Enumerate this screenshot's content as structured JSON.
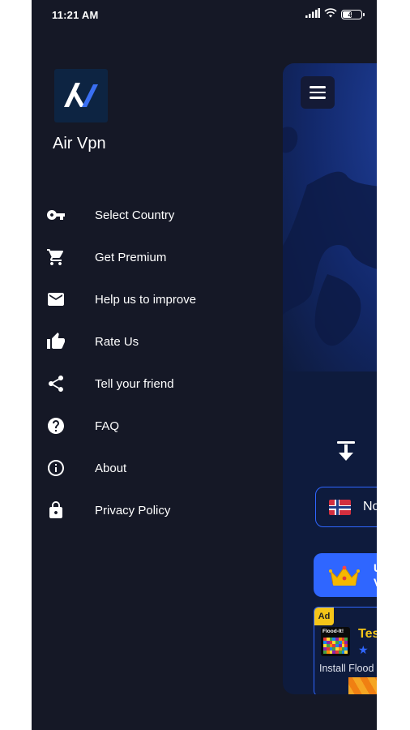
{
  "status_bar": {
    "time": "11:21 AM",
    "battery_level": "44",
    "icons": [
      "signal-icon",
      "wifi-icon",
      "battery-icon"
    ]
  },
  "drawer": {
    "app_name": "Air Vpn",
    "logo_icon": "air-vpn-logo-icon",
    "menu": [
      {
        "label": "Select Country",
        "icon": "key-icon"
      },
      {
        "label": "Get Premium",
        "icon": "cart-icon"
      },
      {
        "label": "Help us to improve",
        "icon": "mail-icon"
      },
      {
        "label": "Rate Us",
        "icon": "thumbs-up-icon"
      },
      {
        "label": "Tell your friend",
        "icon": "share-icon"
      },
      {
        "label": "FAQ",
        "icon": "help-circle-icon"
      },
      {
        "label": "About",
        "icon": "info-icon"
      },
      {
        "label": "Privacy Policy",
        "icon": "lock-icon"
      }
    ]
  },
  "main": {
    "menu_button_icon": "hamburger-icon",
    "connect_icon": "upload-arrow-icon",
    "country_partial": "No",
    "premium_partial_1": "U",
    "premium_partial_2": "V",
    "ad": {
      "badge": "Ad",
      "thumb_title": "Flood-It!",
      "title_partial": "Tes",
      "stars": "★",
      "desc_partial": "Install Flood"
    }
  },
  "colors": {
    "background": "#151826",
    "card": "#0e1b3d",
    "accent": "#2f66ff",
    "ad_yellow": "#f5c518"
  }
}
